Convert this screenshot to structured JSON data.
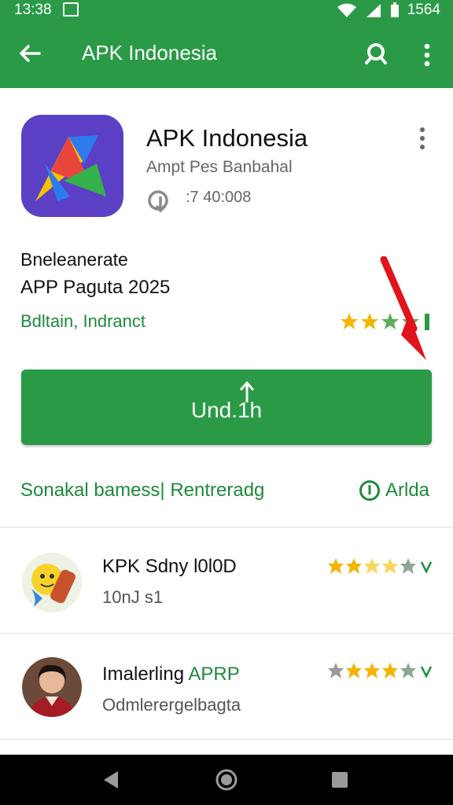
{
  "status_bar": {
    "time": "13:38",
    "time_right": "1564"
  },
  "app_bar": {
    "title": "APK Indonesia"
  },
  "app": {
    "name": "APK Indonesia",
    "developer": "Ampt Pes Banbahal",
    "size": ":7 40:008",
    "description_line1": "Bneleanerate",
    "description_line2": "APP Paguta 2025",
    "category": "Bdltain, Indranct",
    "rating_stars": 4
  },
  "install_button": {
    "label": "Und.1h"
  },
  "links": {
    "left": "Sonakal bamess| Rentreradg",
    "right": "Arlda"
  },
  "list_items": [
    {
      "title": "KPK Sdny l0l0D",
      "subtitle": "10nJ s1",
      "stars": 3
    },
    {
      "title": "Imalerling",
      "title_accent": "APRP",
      "subtitle": "Odmlerergelbagta",
      "stars": 4
    }
  ],
  "colors": {
    "primary": "#2a9a47",
    "accent_text": "#1d8a3c",
    "star": "#f4b400",
    "annotation": "#e0141a"
  },
  "icons": [
    "back-arrow-icon",
    "search-icon",
    "more-vert-icon",
    "download-icon",
    "info-icon",
    "star-icon",
    "chevron-down-icon"
  ]
}
